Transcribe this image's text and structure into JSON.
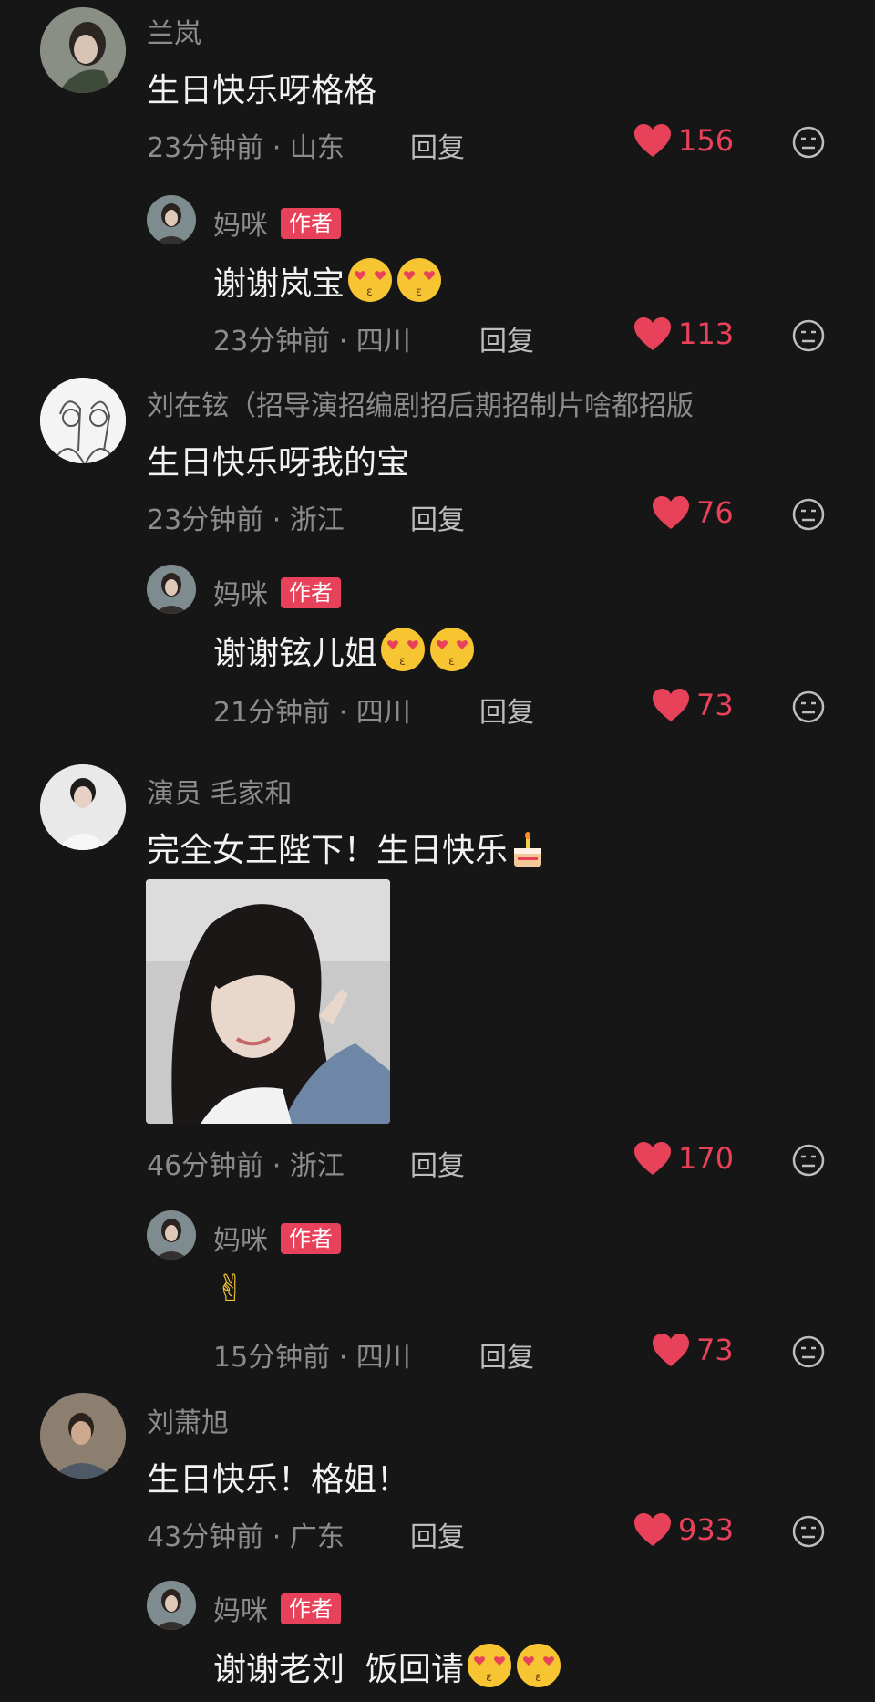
{
  "reply_label": "回复",
  "author_badge": "作者",
  "colors": {
    "background": "#161616",
    "accent": "#e8415a",
    "muted": "#8c8c8c"
  },
  "icons": {
    "like": "heart-icon",
    "dislike": "dislike-face-icon",
    "emoji": "heart-eyes-kiss-emoji"
  },
  "comments": [
    {
      "name": "兰岚",
      "text": "生日快乐呀格格",
      "time": "23分钟前",
      "location": "山东",
      "likes": "156"
    },
    {
      "name": "妈咪",
      "text": "谢谢岚宝",
      "time": "23分钟前",
      "location": "四川",
      "likes": "113"
    },
    {
      "name": "刘在铉（招导演招编剧招后期招制片啥都招版",
      "text": "生日快乐呀我的宝",
      "time": "23分钟前",
      "location": "浙江",
      "likes": "76"
    },
    {
      "name": "妈咪",
      "text": "谢谢铉儿姐",
      "time": "21分钟前",
      "location": "四川",
      "likes": "73"
    },
    {
      "name": "演员 毛家和",
      "text": "完全女王陛下！生日快乐",
      "time": "46分钟前",
      "location": "浙江",
      "likes": "170"
    },
    {
      "name": "妈咪",
      "text": "✌",
      "time": "15分钟前",
      "location": "四川",
      "likes": "73"
    },
    {
      "name": "刘萧旭",
      "text": "生日快乐！格姐！",
      "time": "43分钟前",
      "location": "广东",
      "likes": "933"
    },
    {
      "name": "妈咪",
      "text": "谢谢老刘  饭回请"
    }
  ]
}
